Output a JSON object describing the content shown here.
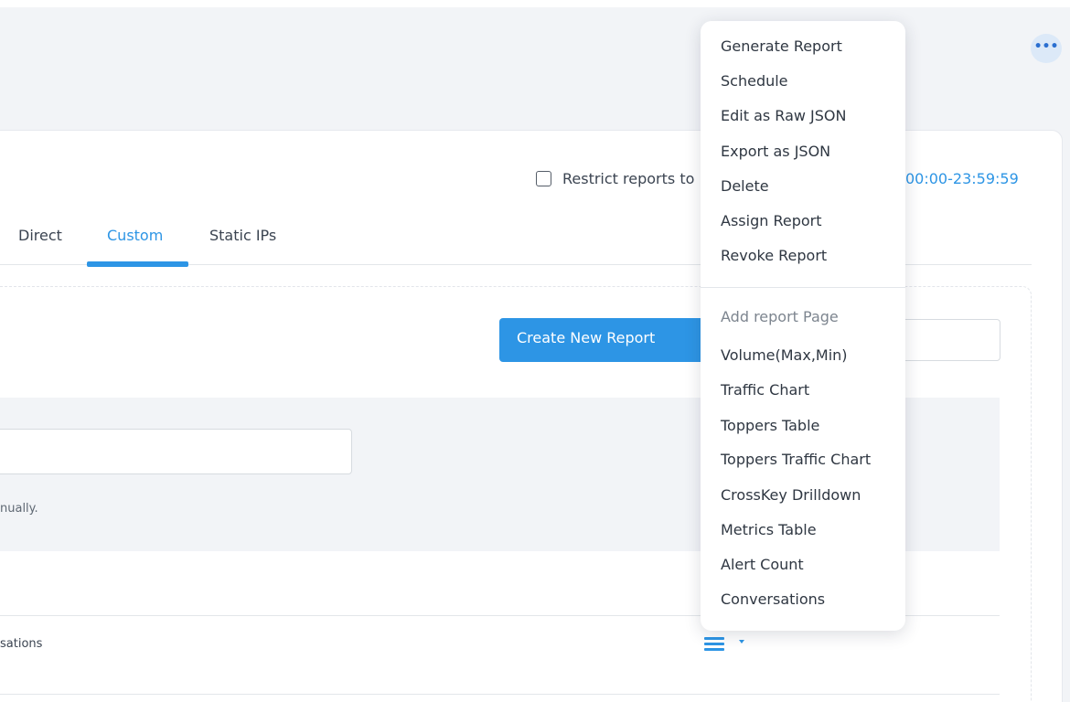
{
  "header": {
    "more_label": "•••"
  },
  "restrict": {
    "label": "Restrict reports to",
    "time_range": "00:00-23:59:59"
  },
  "tabs": [
    {
      "label": "Direct"
    },
    {
      "label": "Custom",
      "active": true
    },
    {
      "label": "Static IPs"
    }
  ],
  "toolbar": {
    "create_label": "Create New Report"
  },
  "form": {
    "hint": "nually."
  },
  "list": {
    "row_label": "sations"
  },
  "colors": {
    "accent": "#2d95e5",
    "page_bg": "#f2f4f7",
    "panel_bg": "#f2f4f7",
    "text": "#3b4451"
  },
  "icons": {
    "more": "ellipsis-icon",
    "row_menu": "hamburger-menu-icon",
    "row_caret": "caret-down-icon"
  },
  "dropdown": {
    "actions": [
      {
        "label": "Generate Report"
      },
      {
        "label": "Schedule"
      },
      {
        "label": "Edit as Raw JSON"
      },
      {
        "label": "Export as JSON"
      },
      {
        "label": "Delete"
      },
      {
        "label": "Assign Report"
      },
      {
        "label": "Revoke Report"
      }
    ],
    "section_header": "Add report Page",
    "pages": [
      {
        "label": "Volume(Max,Min)"
      },
      {
        "label": "Traffic Chart"
      },
      {
        "label": "Toppers Table"
      },
      {
        "label": "Toppers Traffic Chart"
      },
      {
        "label": "CrossKey Drilldown"
      },
      {
        "label": "Metrics Table"
      },
      {
        "label": "Alert Count"
      },
      {
        "label": "Conversations"
      }
    ]
  }
}
